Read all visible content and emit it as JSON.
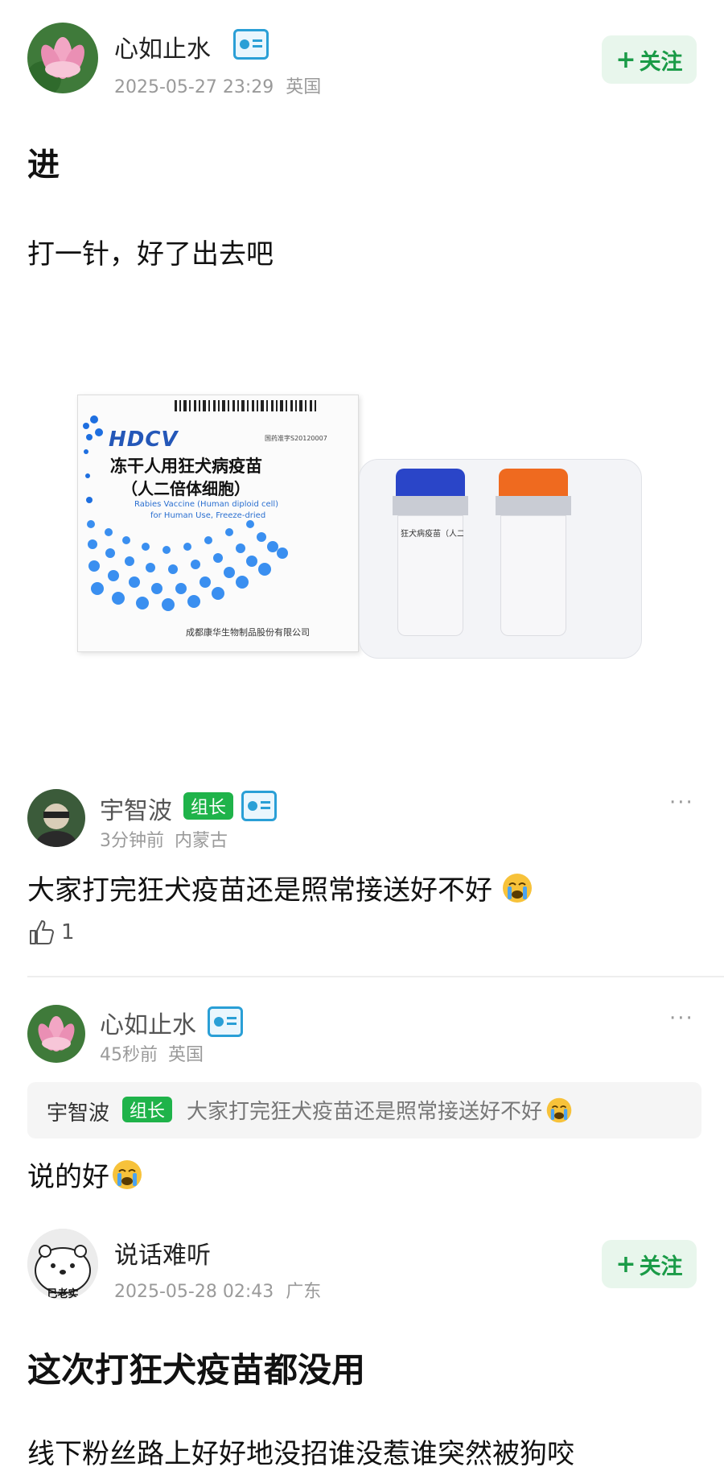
{
  "post1": {
    "author": "心如止水",
    "time": "2025-05-27 23:29",
    "location": "英国",
    "follow_label": "关注",
    "title": "进",
    "text": "打一针，好了出去吧"
  },
  "product": {
    "brand": "HDCV",
    "approval": "国药准字S20120007",
    "name_line1": "冻干人用狂犬病疫苗",
    "name_line2": "（人二倍体细胞）",
    "english_line1": "Rabies Vaccine (Human diploid cell)",
    "english_line2": "for Human Use, Freeze-dried",
    "maker": "成都康华生物制品股份有限公司",
    "vial_label": "狂犬病疫苗（人二",
    "cap_colors": [
      "#2a45c8",
      "#ef6a1f"
    ]
  },
  "comment1": {
    "author": "宇智波",
    "role": "组长",
    "time": "3分钟前",
    "location": "内蒙古",
    "text": "大家打完狂犬疫苗还是照常接送好不好",
    "likes": "1",
    "more": "···"
  },
  "comment2": {
    "author": "心如止水",
    "time": "45秒前",
    "location": "英国",
    "quote_author": "宇智波",
    "quote_role": "组长",
    "quote_text": "大家打完狂犬疫苗还是照常接送好不好",
    "text": "说的好",
    "more": "···"
  },
  "post2": {
    "author": "说话难听",
    "avatar_text": "已老实",
    "time": "2025-05-28 02:43",
    "location": "广东",
    "follow_label": "关注",
    "title": "这次打狂犬疫苗都没用",
    "text": "线下粉丝路上好好地没招谁没惹谁突然被狗咬"
  }
}
